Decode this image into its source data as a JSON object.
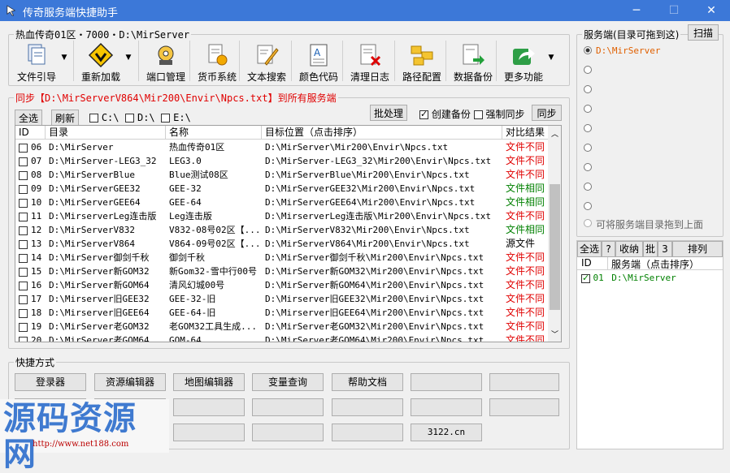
{
  "window": {
    "title": "传奇服务端快捷助手",
    "min": "─",
    "max": "☐",
    "close": "✕"
  },
  "top_group": {
    "legend": "热血传奇01区・7000・D:\\MirServer"
  },
  "toolbar": [
    {
      "label": "文件引导",
      "icon": "file-stack-icon",
      "dropdown": true
    },
    {
      "label": "重新加载",
      "icon": "warning-reload-icon",
      "dropdown": true
    },
    {
      "label": "端口管理",
      "icon": "gear-port-icon",
      "dropdown": false
    },
    {
      "label": "货币系统",
      "icon": "coin-doc-icon",
      "dropdown": false
    },
    {
      "label": "文本搜索",
      "icon": "pencil-doc-icon",
      "dropdown": false
    },
    {
      "label": "颜色代码",
      "icon": "text-doc-icon",
      "dropdown": false
    },
    {
      "label": "清理日志",
      "icon": "delete-doc-icon",
      "dropdown": false
    },
    {
      "label": "路径配置",
      "icon": "folders-icon",
      "dropdown": false
    },
    {
      "label": "数据备份",
      "icon": "backup-doc-icon",
      "dropdown": false
    },
    {
      "label": "更多功能",
      "icon": "share-icon",
      "dropdown": true
    }
  ],
  "sync": {
    "prefix": "同步【",
    "path": "D:\\MirServerV864\\Mir200\\Envir\\Npcs.txt",
    "suffix": "】到所有服务端"
  },
  "actions": {
    "select_all": "全选",
    "refresh": "刷新",
    "drive_c": "C:\\",
    "drive_d": "D:\\",
    "drive_e": "E:\\",
    "batch": "批处理",
    "create_backup": "创建备份",
    "force_sync": "强制同步",
    "sync_btn": "同步"
  },
  "table": {
    "headers": [
      "ID",
      "目录",
      "名称",
      "目标位置（点击排序）",
      "对比结果"
    ],
    "rows": [
      {
        "id": "06",
        "dir": "D:\\MirServer",
        "name": "热血传奇01区",
        "target": "D:\\MirServer\\Mir200\\Envir\\Npcs.txt",
        "result": "文件不同",
        "color": "red"
      },
      {
        "id": "07",
        "dir": "D:\\MirServer-LEG3_32",
        "name": "LEG3.0",
        "target": "D:\\MirServer-LEG3_32\\Mir200\\Envir\\Npcs.txt",
        "result": "文件不同",
        "color": "red"
      },
      {
        "id": "08",
        "dir": "D:\\MirServerBlue",
        "name": "Blue测试08区",
        "target": "D:\\MirServerBlue\\Mir200\\Envir\\Npcs.txt",
        "result": "文件不同",
        "color": "red"
      },
      {
        "id": "09",
        "dir": "D:\\MirServerGEE32",
        "name": "GEE-32",
        "target": "D:\\MirServerGEE32\\Mir200\\Envir\\Npcs.txt",
        "result": "文件相同",
        "color": "green"
      },
      {
        "id": "10",
        "dir": "D:\\MirServerGEE64",
        "name": "GEE-64",
        "target": "D:\\MirServerGEE64\\Mir200\\Envir\\Npcs.txt",
        "result": "文件相同",
        "color": "green"
      },
      {
        "id": "11",
        "dir": "D:\\MirserverLeg连击版",
        "name": "Leg连击版",
        "target": "D:\\MirserverLeg连击版\\Mir200\\Envir\\Npcs.txt",
        "result": "文件不同",
        "color": "red"
      },
      {
        "id": "12",
        "dir": "D:\\MirServerV832",
        "name": "V832-08号02区【...",
        "target": "D:\\MirServerV832\\Mir200\\Envir\\Npcs.txt",
        "result": "文件相同",
        "color": "green"
      },
      {
        "id": "13",
        "dir": "D:\\MirServerV864",
        "name": "V864-09号02区【...",
        "target": "D:\\MirServerV864\\Mir200\\Envir\\Npcs.txt",
        "result": "源文件",
        "color": "black"
      },
      {
        "id": "14",
        "dir": "D:\\MirServer御剑千秋",
        "name": "御剑千秋",
        "target": "D:\\MirServer御剑千秋\\Mir200\\Envir\\Npcs.txt",
        "result": "文件不同",
        "color": "red"
      },
      {
        "id": "15",
        "dir": "D:\\MirServer新GOM32",
        "name": "新Gom32-雪中行00号",
        "target": "D:\\MirServer新GOM32\\Mir200\\Envir\\Npcs.txt",
        "result": "文件不同",
        "color": "red"
      },
      {
        "id": "16",
        "dir": "D:\\MirServer新GOM64",
        "name": "清风幻城00号",
        "target": "D:\\MirServer新GOM64\\Mir200\\Envir\\Npcs.txt",
        "result": "文件不同",
        "color": "red"
      },
      {
        "id": "17",
        "dir": "D:\\Mirserver旧GEE32",
        "name": "GEE-32-旧",
        "target": "D:\\Mirserver旧GEE32\\Mir200\\Envir\\Npcs.txt",
        "result": "文件不同",
        "color": "red"
      },
      {
        "id": "18",
        "dir": "D:\\Mirserver旧GEE64",
        "name": "GEE-64-旧",
        "target": "D:\\Mirserver旧GEE64\\Mir200\\Envir\\Npcs.txt",
        "result": "文件不同",
        "color": "red"
      },
      {
        "id": "19",
        "dir": "D:\\MirServer老GOM32",
        "name": "老GOM32工具生成...",
        "target": "D:\\MirServer老GOM32\\Mir200\\Envir\\Npcs.txt",
        "result": "文件不同",
        "color": "red"
      },
      {
        "id": "20",
        "dir": "D:\\MirServer老GOM64",
        "name": "GOM-64",
        "target": "D:\\MirServer老GOM64\\Mir200\\Envir\\Npcs.txt",
        "result": "文件不同",
        "color": "red"
      }
    ]
  },
  "shortcuts": {
    "legend": "快捷方式",
    "buttons": [
      "登录器",
      "资源编辑器",
      "地图编辑器",
      "变量查询",
      "帮助文档",
      "",
      "",
      "",
      "",
      "",
      "",
      "",
      "",
      "",
      "",
      "",
      "",
      "",
      "",
      "3122.cn"
    ]
  },
  "watermark": {
    "big": "源码资源网",
    "url": "http://www.net188.com"
  },
  "server_panel": {
    "legend": "服务端(目录可拖到这)",
    "scan": "扫描",
    "selected": "D:\\MirServer",
    "hint": "可将服务端目录拖到上面"
  },
  "bottom_right": {
    "tabs": [
      "全选",
      "?",
      "收纳",
      "批",
      "3",
      "排列"
    ],
    "col_id": "ID",
    "col_server": "服务端（点击排序）",
    "row_id": "01",
    "row_server": "D:\\MirServer"
  },
  "colors": {
    "titlebar": "#3c78d8",
    "accent": "#e00000",
    "same": "#008000"
  }
}
